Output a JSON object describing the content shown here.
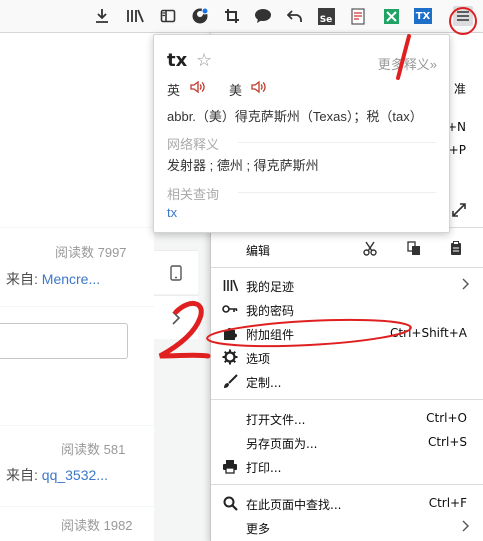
{
  "colors": {
    "link": "#3b77c9",
    "annotation": "#e02020",
    "menu_border": "#c8c8ca"
  },
  "toolbar": {
    "icons": [
      "download-icon",
      "library-icon",
      "sidebar-icon",
      "account-icon",
      "screenshot-crop-icon",
      "chat-bubble-icon",
      "back-arrow-icon",
      "selenium-icon",
      "notes-icon",
      "spreadsheet-icon",
      "translate-tx-icon",
      "menu-hamburger-icon"
    ],
    "selenium_badge": "Se",
    "tx_badge": "TX"
  },
  "background": {
    "row1": {
      "reads": "阅读数 7997",
      "source_label": "来自:",
      "source_link": "Mencre..."
    },
    "row2": {
      "reads": "阅读数 581",
      "source_label": "来自:",
      "source_link": "qq_3532..."
    },
    "row3": {
      "reads": "阅读数 1982"
    }
  },
  "dict": {
    "word": "tx",
    "star": "☆",
    "more": "更多释义»",
    "uk_label": "英",
    "us_label": "美",
    "definition": "abbr.（美）得克萨斯州（Texas）；税（tax）",
    "web_title": "网络释义",
    "web_def": "发射器 ; 德州 ; 得克萨斯州",
    "related_title": "相关查询",
    "related_link": "tx"
  },
  "menu": {
    "partial_top": "准",
    "shortcut_new_window": "+N",
    "shortcut_private": "+P",
    "edit_label": "编辑",
    "items": [
      {
        "label": "我的足迹",
        "shortcut": "",
        "icon": "library-icon",
        "arrow": true
      },
      {
        "label": "我的密码",
        "shortcut": "",
        "icon": "key-icon",
        "arrow": false
      },
      {
        "label": "附加组件",
        "shortcut": "Ctrl+Shift+A",
        "icon": "puzzle-icon",
        "arrow": false
      },
      {
        "label": "选项",
        "shortcut": "",
        "icon": "gear-icon",
        "arrow": false
      },
      {
        "label": "定制...",
        "shortcut": "",
        "icon": "brush-icon",
        "arrow": false
      },
      {
        "label": "打开文件...",
        "shortcut": "Ctrl+O",
        "icon": "",
        "arrow": false
      },
      {
        "label": "另存页面为...",
        "shortcut": "Ctrl+S",
        "icon": "",
        "arrow": false
      },
      {
        "label": "打印...",
        "shortcut": "",
        "icon": "printer-icon",
        "arrow": false
      },
      {
        "label": "在此页面中查找...",
        "shortcut": "Ctrl+F",
        "icon": "search-icon",
        "arrow": false
      },
      {
        "label": "更多",
        "shortcut": "",
        "icon": "",
        "arrow": true
      }
    ]
  },
  "annotations": {
    "mark1": "1",
    "mark2": "2"
  }
}
